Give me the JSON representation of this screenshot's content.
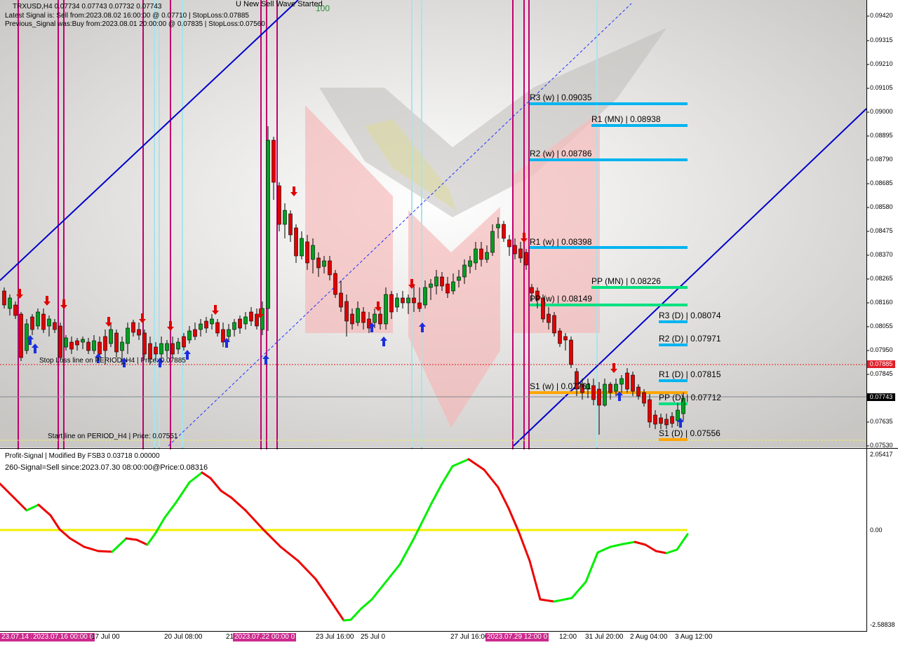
{
  "window": {
    "symbol_line": "TRXUSD,H4  0.07734 0.07743 0.07732 0.07743",
    "latest_signal": "Latest Signal is: Sell from:2023.08.02 16:00:00 @ 0.07710 | StopLoss:0.07885",
    "previous_signal": "Previous_Signal was:Buy from:2023.08.01 20:00:00 @ 0.07835 | StopLoss:0.07560",
    "top_notice": "U New Sell Wave Started",
    "top_number": "100"
  },
  "chart": {
    "stop_loss_label": "Stop Loss line on PERIOD_H4 | Price: 0.07885",
    "start_line_label": "Start line on PERIOD_H4 | Price: 0.07551",
    "pivots": [
      {
        "key": "r3w",
        "label": "R3 (w) | 0.09035",
        "color": "#00b4f0"
      },
      {
        "key": "r1mn",
        "label": "R1 (MN) | 0.08938",
        "color": "#00b4f0"
      },
      {
        "key": "r2w",
        "label": "R2 (w) | 0.08786",
        "color": "#00b4f0"
      },
      {
        "key": "r1w",
        "label": "R1 (w) | 0.08398",
        "color": "#00b4f0"
      },
      {
        "key": "ppmn",
        "label": "PP (MN) | 0.08226",
        "color": "#00e080"
      },
      {
        "key": "ppw",
        "label": "PP (w) | 0.08149",
        "color": "#00e080"
      },
      {
        "key": "r3d",
        "label": "R3 (D) | 0.08074",
        "color": "#00b4f0"
      },
      {
        "key": "r2d",
        "label": "R2 (D) | 0.07971",
        "color": "#00b4f0"
      },
      {
        "key": "r1d",
        "label": "R1 (D) | 0.07815",
        "color": "#00b4f0"
      },
      {
        "key": "s1w",
        "label": "S1 (w) | 0.07761",
        "color": "#ffa500"
      },
      {
        "key": "ppd",
        "label": "PP (D) | 0.07712",
        "color": "#00e080"
      },
      {
        "key": "s1d",
        "label": "S1 (D) | 0.07556",
        "color": "#ffa500"
      }
    ],
    "price_axis": [
      "0.09420",
      "0.09315",
      "0.09210",
      "0.09105",
      "0.09000",
      "0.08895",
      "0.08790",
      "0.08685",
      "0.08580",
      "0.08475",
      "0.08370",
      "0.08265",
      "0.08160",
      "0.08055",
      "0.07950",
      "0.07845",
      "0.07635",
      "0.07530"
    ],
    "price_badges": [
      {
        "key": "stoploss",
        "text": "0.07885",
        "bg": "#e0202a",
        "fg": "#ffffff"
      },
      {
        "key": "current",
        "text": "0.07743",
        "bg": "#000000",
        "fg": "#ffffff"
      }
    ],
    "time_axis": [
      "17 Jul 00",
      "20 Jul 08:00",
      "21",
      "23 Jul 16:00",
      "25 Jul 0",
      "27 Jul 16:00",
      "12:00",
      "31 Jul 20:00",
      "2 Aug 04:00",
      "3 Aug 12:00"
    ],
    "time_axis_highlights": [
      "23.07.14 2",
      "2023.07.16 00:00 0",
      "2023.07.22 00:00 0",
      "2023.07.29 12:00 0"
    ]
  },
  "indicator": {
    "title": "Profit-Signal | Modified By FSB3 0.03718 0.00000",
    "signal_text": "260-Signal=Sell since:2023.07.30 08:00:00@Price:0.08316",
    "axis_top": "2.05417",
    "axis_zero": "0.00",
    "axis_bottom": "-2.58838"
  },
  "colors": {
    "bull": "#00a020",
    "bear": "#e00000",
    "trend_line": "#0000cc",
    "magenta_line": "#c0006e",
    "cyan_line": "#a8e4ec",
    "osc_up": "#00ee00",
    "osc_down": "#ee0000",
    "zero_line": "#f0f000"
  }
}
